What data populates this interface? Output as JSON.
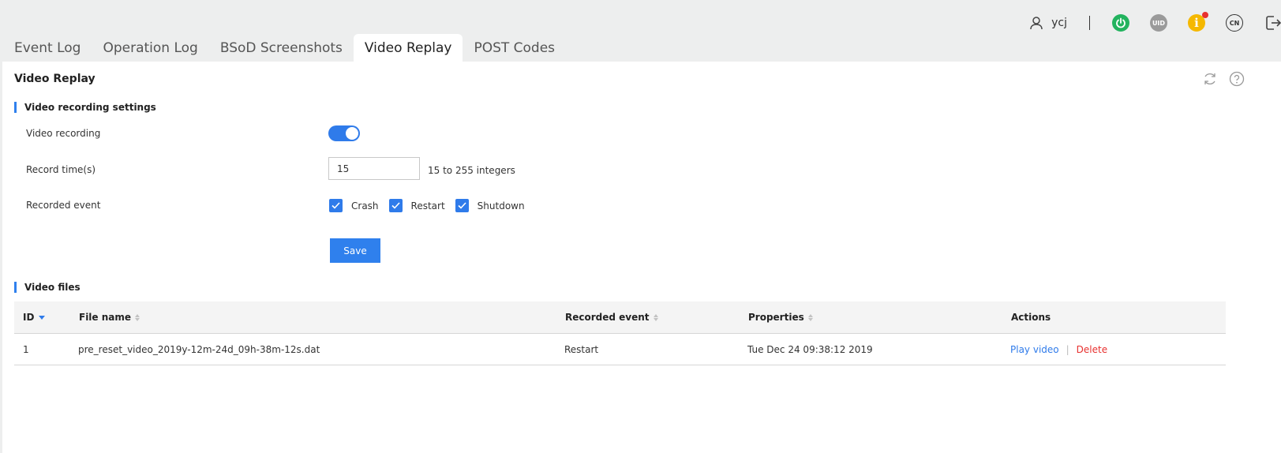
{
  "header": {
    "username": "ycj",
    "uid_label": "UID",
    "info_label": "i",
    "language_label": "CN"
  },
  "tabs": [
    {
      "label": "Event Log",
      "active": false
    },
    {
      "label": "Operation Log",
      "active": false
    },
    {
      "label": "BSoD Screenshots",
      "active": false
    },
    {
      "label": "Video Replay",
      "active": true
    },
    {
      "label": "POST Codes",
      "active": false
    }
  ],
  "panel": {
    "title": "Video Replay"
  },
  "settings": {
    "section_title": "Video recording settings",
    "video_recording_label": "Video recording",
    "video_recording_enabled": true,
    "record_time_label": "Record time(s)",
    "record_time_value": "15",
    "record_time_hint": "15 to 255 integers",
    "recorded_event_label": "Recorded event",
    "events": [
      {
        "label": "Crash",
        "checked": true
      },
      {
        "label": "Restart",
        "checked": true
      },
      {
        "label": "Shutdown",
        "checked": true
      }
    ],
    "save_label": "Save"
  },
  "files": {
    "section_title": "Video files",
    "columns": {
      "id": "ID",
      "file_name": "File name",
      "recorded_event": "Recorded event",
      "properties": "Properties",
      "actions": "Actions"
    },
    "rows": [
      {
        "id": "1",
        "file_name": "pre_reset_video_2019y-12m-24d_09h-38m-12s.dat",
        "recorded_event": "Restart",
        "properties": "Tue Dec 24 09:38:12 2019",
        "play_label": "Play video",
        "separator": "|",
        "delete_label": "Delete"
      }
    ]
  },
  "colors": {
    "accent": "#2f80ed",
    "toggle_on": "#2f7bea",
    "power_green": "#22b35e",
    "info_yellow": "#f5b800",
    "alert_red": "#e8312f"
  }
}
